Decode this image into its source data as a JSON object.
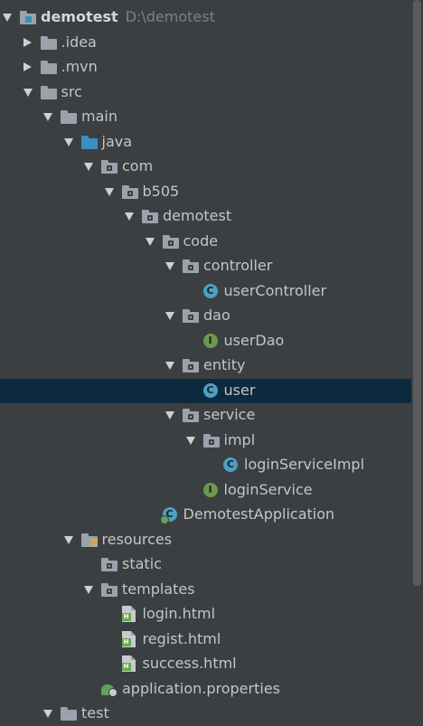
{
  "tree": [
    {
      "label": "demotest",
      "hint": "D:\\demotest",
      "depth": 0,
      "state": "expanded",
      "icon": "module-folder-icon",
      "bold": true
    },
    {
      "label": ".idea",
      "depth": 1,
      "state": "collapsed",
      "icon": "folder-icon"
    },
    {
      "label": ".mvn",
      "depth": 1,
      "state": "collapsed",
      "icon": "folder-icon"
    },
    {
      "label": "src",
      "depth": 1,
      "state": "expanded",
      "icon": "folder-icon"
    },
    {
      "label": "main",
      "depth": 2,
      "state": "expanded",
      "icon": "folder-icon"
    },
    {
      "label": "java",
      "depth": 3,
      "state": "expanded",
      "icon": "source-folder-icon"
    },
    {
      "label": "com",
      "depth": 4,
      "state": "expanded",
      "icon": "package-icon"
    },
    {
      "label": "b505",
      "depth": 5,
      "state": "expanded",
      "icon": "package-icon"
    },
    {
      "label": "demotest",
      "depth": 6,
      "state": "expanded",
      "icon": "package-icon"
    },
    {
      "label": "code",
      "depth": 7,
      "state": "expanded",
      "icon": "package-icon"
    },
    {
      "label": "controller",
      "depth": 8,
      "state": "expanded",
      "icon": "package-icon"
    },
    {
      "label": "userController",
      "depth": 9,
      "state": "leaf",
      "icon": "class-icon"
    },
    {
      "label": "dao",
      "depth": 8,
      "state": "expanded",
      "icon": "package-icon"
    },
    {
      "label": "userDao",
      "depth": 9,
      "state": "leaf",
      "icon": "interface-icon"
    },
    {
      "label": "entity",
      "depth": 8,
      "state": "expanded",
      "icon": "package-icon"
    },
    {
      "label": "user",
      "depth": 9,
      "state": "leaf",
      "icon": "class-icon",
      "selected": true
    },
    {
      "label": "service",
      "depth": 8,
      "state": "expanded",
      "icon": "package-icon"
    },
    {
      "label": "impl",
      "depth": 9,
      "state": "expanded",
      "icon": "package-icon"
    },
    {
      "label": "loginServiceImpl",
      "depth": 10,
      "state": "leaf",
      "icon": "class-icon"
    },
    {
      "label": "loginService",
      "depth": 9,
      "state": "leaf",
      "icon": "interface-icon"
    },
    {
      "label": "DemotestApplication",
      "depth": 7,
      "state": "leaf",
      "icon": "spring-boot-class-icon"
    },
    {
      "label": "resources",
      "depth": 3,
      "state": "expanded",
      "icon": "resources-folder-icon"
    },
    {
      "label": "static",
      "depth": 4,
      "state": "leaf",
      "icon": "package-icon"
    },
    {
      "label": "templates",
      "depth": 4,
      "state": "expanded",
      "icon": "package-icon"
    },
    {
      "label": "login.html",
      "depth": 5,
      "state": "leaf",
      "icon": "html-file-icon"
    },
    {
      "label": "regist.html",
      "depth": 5,
      "state": "leaf",
      "icon": "html-file-icon"
    },
    {
      "label": "success.html",
      "depth": 5,
      "state": "leaf",
      "icon": "html-file-icon"
    },
    {
      "label": "application.properties",
      "depth": 4,
      "state": "leaf",
      "icon": "properties-file-icon"
    },
    {
      "label": "test",
      "depth": 2,
      "state": "expanded",
      "icon": "folder-icon"
    }
  ],
  "colors": {
    "background": "#3c3f41",
    "selection": "#0d293e",
    "text": "#c5c5c5"
  }
}
